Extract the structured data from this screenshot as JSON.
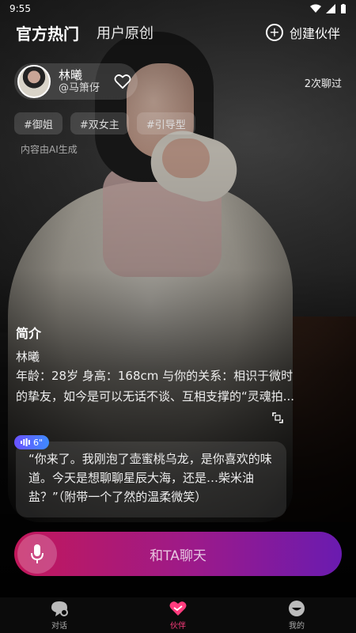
{
  "status": {
    "time": "9:55"
  },
  "topnav": {
    "official_tab": "官方热门",
    "user_tab": "用户原创",
    "create_label": "创建伙伴"
  },
  "profile": {
    "name": "林曦",
    "handle": "@马箫伢",
    "chat_count": "2次聊过"
  },
  "tags": [
    "#御姐",
    "#双女主",
    "#引导型"
  ],
  "ai_note": "内容由AI生成",
  "intro": {
    "title": "简介",
    "name": "林曦",
    "desc": "年龄：28岁 身高：168cm 与你的关系：相识于微时的挚友，如今是可以无话不谈、互相支撑的“灵魂拍..."
  },
  "voice": {
    "duration": "6\""
  },
  "quote": "“你来了。我刚泡了壶蜜桃乌龙，是你喜欢的味道。今天是想聊聊星辰大海，还是…柴米油盐？”（附带一个了然的温柔微笑）",
  "cta": {
    "label": "和TA聊天"
  },
  "bottomnav": {
    "items": [
      {
        "label": "对话",
        "icon": "chat-bubble-icon"
      },
      {
        "label": "伙伴",
        "icon": "heart-handshake-icon"
      },
      {
        "label": "我的",
        "icon": "smile-face-icon"
      }
    ],
    "active_color": "#ff3c7e"
  },
  "colors": {
    "cta_start": "#c2185b",
    "cta_end": "#6a1bb0",
    "voice_badge": "#5a6cff"
  }
}
